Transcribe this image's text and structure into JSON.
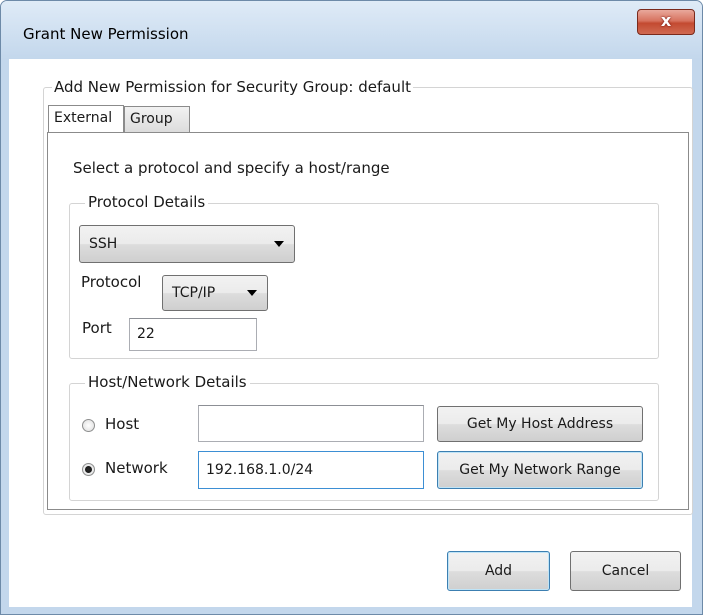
{
  "window": {
    "title": "Grant New Permission",
    "close_glyph": "x"
  },
  "form": {
    "group_title": "Add New Permission for Security Group: default",
    "tabs": [
      {
        "label": "External",
        "selected": true
      },
      {
        "label": "Group",
        "selected": false
      }
    ],
    "instruction": "Select a protocol and specify a host/range",
    "protocol_details": {
      "legend": "Protocol Details",
      "service": "SSH",
      "protocol_label": "Protocol",
      "protocol": "TCP/IP",
      "port_label": "Port",
      "port": "22"
    },
    "host_network": {
      "legend": "Host/Network Details",
      "host_label": "Host",
      "host_value": "",
      "network_label": "Network",
      "network_value": "192.168.1.0/24",
      "selected": "network",
      "get_host_button": "Get My Host Address",
      "get_network_button": "Get My Network Range"
    }
  },
  "footer": {
    "add_button": "Add",
    "cancel_button": "Cancel"
  },
  "colors": {
    "frame": "#c3d7ec",
    "close_button": "#c34a31",
    "focus": "#3d8fd4"
  }
}
